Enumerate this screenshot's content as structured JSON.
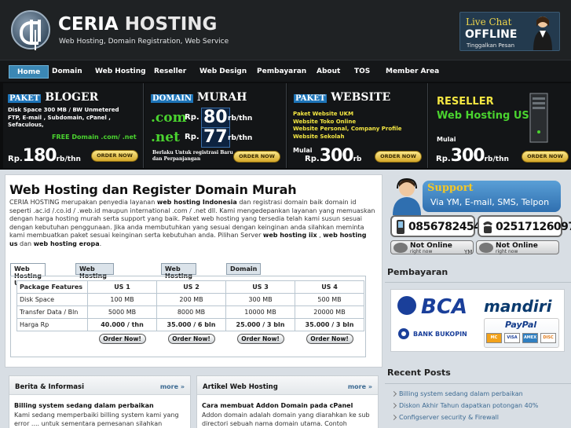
{
  "header": {
    "brand_1": "CERIA",
    "brand_2": "HOSTING",
    "tagline": "Web Hosting, Domain Registration, Web Service",
    "livechat_title": "Live Chat",
    "livechat_status": "OFFLINE",
    "livechat_sub": "Tinggalkan Pesan"
  },
  "nav": [
    "Home",
    "Domain",
    "Web Hosting",
    "Reseller",
    "Web Design",
    "Pembayaran",
    "About",
    "TOS",
    "Member Area"
  ],
  "promo": {
    "bloger": {
      "tag": "PAKET",
      "title": "BLOGER",
      "lines": [
        "Disk Space 300 MB / BW Unmetered",
        "FTP, E-mail , Subdomain, cPanel ,",
        "Sefaculous,"
      ],
      "free": "FREE Domain .com/ .net",
      "rp": "Rp.",
      "price": "180",
      "unit": "rb/thn",
      "order": "ORDER NOW"
    },
    "domain": {
      "tag": "DOMAIN",
      "title": "MURAH",
      "com": ".com",
      "net": ".net",
      "rp": "Rp.",
      "price_com": "80",
      "price_net": "77",
      "unit": "rb/thn",
      "note_1": "Berlaku Untuk registrasi Baru",
      "note_2": "dan Perpanjangan",
      "order": "ORDER NOW"
    },
    "website": {
      "tag": "PAKET",
      "title": "WEBSITE",
      "items": [
        "Paket Website UKM",
        "Website Toko Online",
        "Website Personal, Company Profile",
        "Website Sekolah"
      ],
      "mulai": "Mulai",
      "rp": "Rp.",
      "price": "300",
      "unit": "rb",
      "order": "ORDER NOW"
    },
    "reseller": {
      "title": "RESELLER",
      "subtitle": "Web Hosting US",
      "mulai": "Mulai",
      "rp": "Rp.",
      "price": "300",
      "unit": "rb/thn",
      "order": "ORDER NOW"
    }
  },
  "main": {
    "title": "Web Hosting dan Register Domain Murah",
    "desc_1": "CERIA HOSTING merupakan penyedia layanan ",
    "desc_b1": "web hosting Indonesia",
    "desc_2": " dan registrasi domain baik domain id seperti .ac.id /.co.id / .web.id maupun international .com / .net dll. Kami mengedepankan layanan yang memuaskan dengan harga hosting murah serta support yang baik. Paket web hosting yang tersedia telah kami susun sesuai dengan kebutuhan penggunaan. Jika anda membutuhkan yang sesuai dengan keinginan anda silahkan meminta kami membuatkan paket sesuai keinginan serta kebutuhan anda. Pilihan Server ",
    "desc_b2": "web hosting iix",
    "desc_3": " , ",
    "desc_b3": "web hosting us",
    "desc_4": " dan ",
    "desc_b4": "web hosting eropa",
    "desc_5": ".",
    "tabs": [
      "Web Hosting US",
      "Web Hosting Offshore",
      "Web Hosting IIX",
      "Domain"
    ],
    "table": {
      "headers": [
        "Package Features",
        "US 1",
        "US 2",
        "US 3",
        "US 4"
      ],
      "rows": [
        [
          "Disk Space",
          "100 MB",
          "200 MB",
          "300 MB",
          "500 MB"
        ],
        [
          "Transfer Data / Bln",
          "5000 MB",
          "8000 MB",
          "10000 MB",
          "20000 MB"
        ],
        [
          "Harga Rp",
          "40.000 / thn",
          "35.000 / 6 bln",
          "25.000 / 3 bln",
          "35.000 / 3 bln"
        ]
      ],
      "order_label": "Order Now!"
    }
  },
  "news": {
    "title": "Berita & Informasi",
    "more": "more »",
    "post_title": "Billing system sedang dalam perbaikan",
    "post_text": "Kami sedang memperbaiki billing system kami yang error .... untuk sementara pemesanan silahkan"
  },
  "articles": {
    "title": "Artikel Web Hosting",
    "more": "more »",
    "post_title": "Cara membuat Addon Domain pada cPanel",
    "post_text": "Addon domain adalah domain yang diarahkan ke sub directori sebuah nama domain utama. Contoh"
  },
  "sidebar": {
    "support_title": "Support",
    "support_sub": "Via YM, E-mail, SMS, Telpon",
    "phone_1": "08567824545",
    "phone_2": "02517126097",
    "ym_status": "Not Online",
    "ym_sub": "right now",
    "ym_label": "YM",
    "payment_title": "Pembayaran",
    "bank_bca": "BCA",
    "bank_mandiri": "mandiri",
    "bank_bukopin": "BANK BUKOPIN",
    "paypal": "PayPal",
    "cards": [
      "MC",
      "VISA",
      "AMEX",
      "DISC"
    ],
    "recent_title": "Recent Posts",
    "recent": [
      "Billing system sedang dalam perbaikan",
      "Diskon Akhir Tahun dapatkan potongan 40%",
      "Configserver security & Firewall"
    ]
  },
  "colors": {
    "nav_active": "#3b87b4",
    "promo_green": "#4ad32f",
    "link": "#3c6a92"
  }
}
